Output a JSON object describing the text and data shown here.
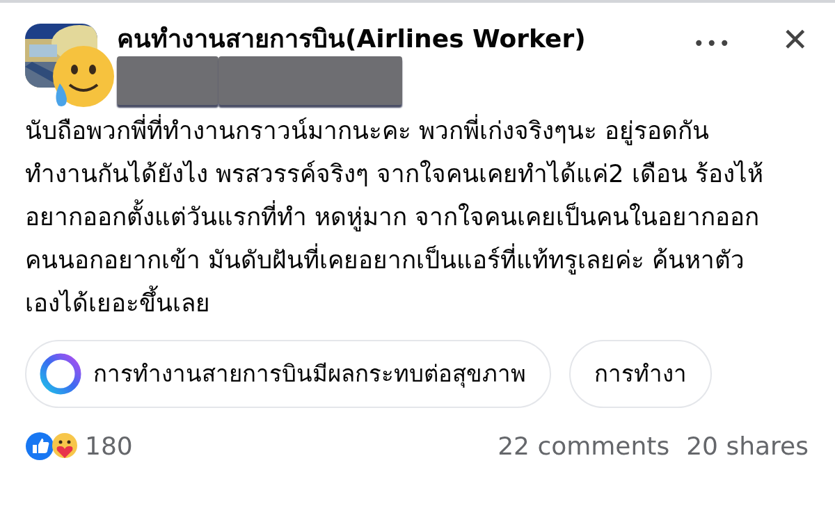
{
  "post": {
    "author": "คนทำงานสายการบิน(Airlines Worker)",
    "more_menu": "•••",
    "close": "✕",
    "body": "นับถือพวกพี่ที่ทำงานกราวน์มากนะคะ พวกพี่เก่งจริงๆนะ อยู่รอดกัน ทำงานกันได้ยังไง พรสวรรค์จริงๆ จากใจคนเคยทำได้แค่2 เดือน ร้องไห้อยากออกตั้งแต่วันแรกที่ทำ หดหู่มาก จากใจคนเคยเป็นคนในอยากออก คนนอกอยากเข้า มันดับฝันที่เคยอยากเป็นแอร์ที่แท้ทรูเลยค่ะ  ค้นหาตัวเองได้เยอะขึ้นเลย"
  },
  "suggestions": [
    {
      "label": "การทำงานสายการบินมีผลกระทบต่อสุขภาพ",
      "kind": "ai"
    },
    {
      "label": "การทำงา",
      "kind": "plain"
    }
  ],
  "footer": {
    "reactions": "180",
    "comments": "22 comments",
    "shares": "20 shares"
  }
}
